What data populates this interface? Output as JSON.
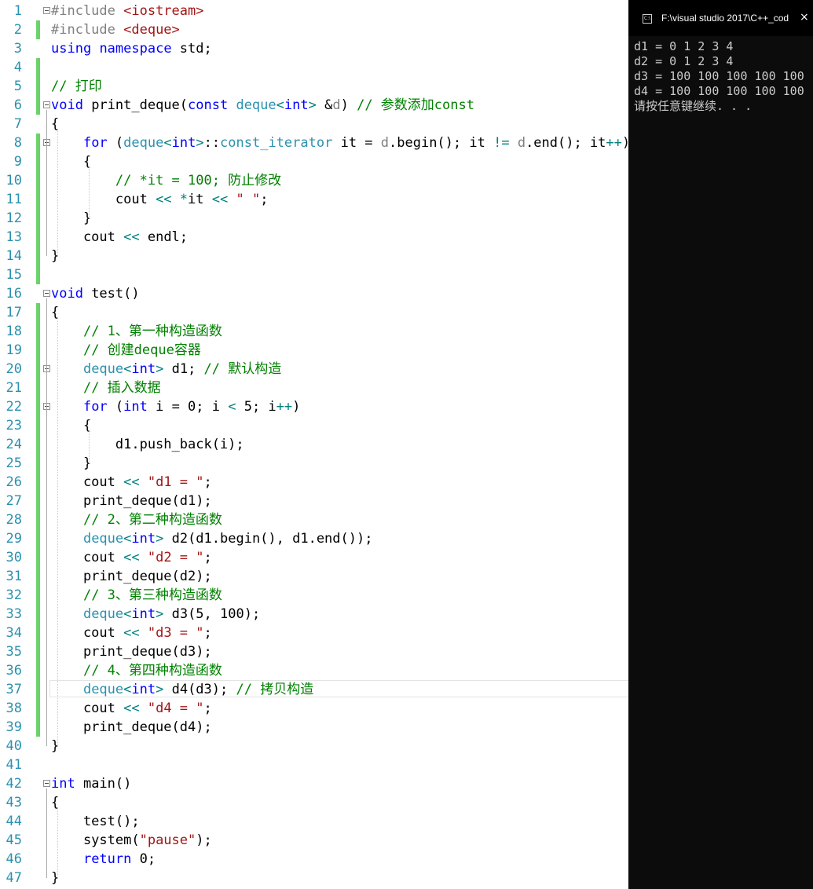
{
  "editor": {
    "lines": [
      {
        "n": "1",
        "html": "<span class=\"pp\">#include </span><span class=\"st\">&lt;iostream&gt;</span>"
      },
      {
        "n": "2",
        "html": "<span class=\"pp\">#include </span><span class=\"st\">&lt;deque&gt;</span>"
      },
      {
        "n": "3",
        "html": "<span class=\"kw\">using</span> <span class=\"kw\">namespace</span> std;"
      },
      {
        "n": "4",
        "html": ""
      },
      {
        "n": "5",
        "html": "<span class=\"cm\">// 打印</span>"
      },
      {
        "n": "6",
        "html": "<span class=\"kw\">void</span> print_deque(<span class=\"kw\">const</span> <span class=\"ty\">deque</span><span class=\"op\">&lt;</span><span class=\"kw\">int</span><span class=\"op\">&gt;</span> &amp;<span class=\"pp\">d</span>) <span class=\"cm\">// 参数添加const</span>"
      },
      {
        "n": "7",
        "html": "{"
      },
      {
        "n": "8",
        "html": "    <span class=\"kw\">for</span> (<span class=\"ty\">deque</span><span class=\"op\">&lt;</span><span class=\"kw\">int</span><span class=\"op\">&gt;</span>::<span class=\"ty\">const_iterator</span> it = <span class=\"pp\">d</span>.begin(); it <span class=\"op\">!=</span> <span class=\"pp\">d</span>.end(); it<span class=\"op\">++</span>)"
      },
      {
        "n": "9",
        "html": "    {"
      },
      {
        "n": "10",
        "html": "        <span class=\"cm\">// *it = 100; 防止修改</span>"
      },
      {
        "n": "11",
        "html": "        cout <span class=\"op\">&lt;&lt;</span> <span class=\"op\">*</span>it <span class=\"op\">&lt;&lt;</span> <span class=\"st\">\" \"</span>;"
      },
      {
        "n": "12",
        "html": "    }"
      },
      {
        "n": "13",
        "html": "    cout <span class=\"op\">&lt;&lt;</span> endl;"
      },
      {
        "n": "14",
        "html": "}"
      },
      {
        "n": "15",
        "html": ""
      },
      {
        "n": "16",
        "html": "<span class=\"kw\">void</span> test()"
      },
      {
        "n": "17",
        "html": "{"
      },
      {
        "n": "18",
        "html": "    <span class=\"cm\">// 1、第一种构造函数</span>"
      },
      {
        "n": "19",
        "html": "    <span class=\"cm\">// 创建deque容器</span>"
      },
      {
        "n": "20",
        "html": "    <span class=\"ty\">deque</span><span class=\"op\">&lt;</span><span class=\"kw\">int</span><span class=\"op\">&gt;</span> d1; <span class=\"cm\">// 默认构造</span>"
      },
      {
        "n": "21",
        "html": "    <span class=\"cm\">// 插入数据</span>"
      },
      {
        "n": "22",
        "html": "    <span class=\"kw\">for</span> (<span class=\"kw\">int</span> i = 0; i <span class=\"op\">&lt;</span> 5; i<span class=\"op\">++</span>)"
      },
      {
        "n": "23",
        "html": "    {"
      },
      {
        "n": "24",
        "html": "        d1.push_back(i);"
      },
      {
        "n": "25",
        "html": "    }"
      },
      {
        "n": "26",
        "html": "    cout <span class=\"op\">&lt;&lt;</span> <span class=\"st\">\"d1 = \"</span>;"
      },
      {
        "n": "27",
        "html": "    print_deque(d1);"
      },
      {
        "n": "28",
        "html": "    <span class=\"cm\">// 2、第二种构造函数</span>"
      },
      {
        "n": "29",
        "html": "    <span class=\"ty\">deque</span><span class=\"op\">&lt;</span><span class=\"kw\">int</span><span class=\"op\">&gt;</span> d2(d1.begin(), d1.end());"
      },
      {
        "n": "30",
        "html": "    cout <span class=\"op\">&lt;&lt;</span> <span class=\"st\">\"d2 = \"</span>;"
      },
      {
        "n": "31",
        "html": "    print_deque(d2);"
      },
      {
        "n": "32",
        "html": "    <span class=\"cm\">// 3、第三种构造函数</span>"
      },
      {
        "n": "33",
        "html": "    <span class=\"ty\">deque</span><span class=\"op\">&lt;</span><span class=\"kw\">int</span><span class=\"op\">&gt;</span> d3(5, 100);"
      },
      {
        "n": "34",
        "html": "    cout <span class=\"op\">&lt;&lt;</span> <span class=\"st\">\"d3 = \"</span>;"
      },
      {
        "n": "35",
        "html": "    print_deque(d3);"
      },
      {
        "n": "36",
        "html": "    <span class=\"cm\">// 4、第四种构造函数</span>"
      },
      {
        "n": "37",
        "html": "    <span class=\"ty\">deque</span><span class=\"op\">&lt;</span><span class=\"kw\">int</span><span class=\"op\">&gt;</span> d4(d3); <span class=\"cm\">// 拷贝构造</span>"
      },
      {
        "n": "38",
        "html": "    cout <span class=\"op\">&lt;&lt;</span> <span class=\"st\">\"d4 = \"</span>;"
      },
      {
        "n": "39",
        "html": "    print_deque(d4);"
      },
      {
        "n": "40",
        "html": "}"
      },
      {
        "n": "41",
        "html": ""
      },
      {
        "n": "42",
        "html": "<span class=\"kw\">int</span> main()"
      },
      {
        "n": "43",
        "html": "{"
      },
      {
        "n": "44",
        "html": "    test();"
      },
      {
        "n": "45",
        "html": "    system(<span class=\"st\">\"pause\"</span>);"
      },
      {
        "n": "46",
        "html": "    <span class=\"kw\">return</span> 0;"
      },
      {
        "n": "47",
        "html": "}"
      }
    ],
    "colors": {
      "keyword": "#0000ff",
      "type": "#2b91af",
      "comment": "#008000",
      "string": "#a31515",
      "preprocessor": "#808080",
      "operator": "#008080",
      "line_number": "#2b91af",
      "change_marker": "#6bd36b"
    }
  },
  "console": {
    "title": "F:\\visual studio 2017\\C++_cod",
    "icon": "console-app-icon",
    "close_glyph": "×",
    "lines": [
      "d1 = 0 1 2 3 4",
      "d2 = 0 1 2 3 4",
      "d3 = 100 100 100 100 100",
      "d4 = 100 100 100 100 100",
      "请按任意键继续. . ."
    ],
    "background": "#0c0c0c",
    "text_color": "#cccccc"
  }
}
